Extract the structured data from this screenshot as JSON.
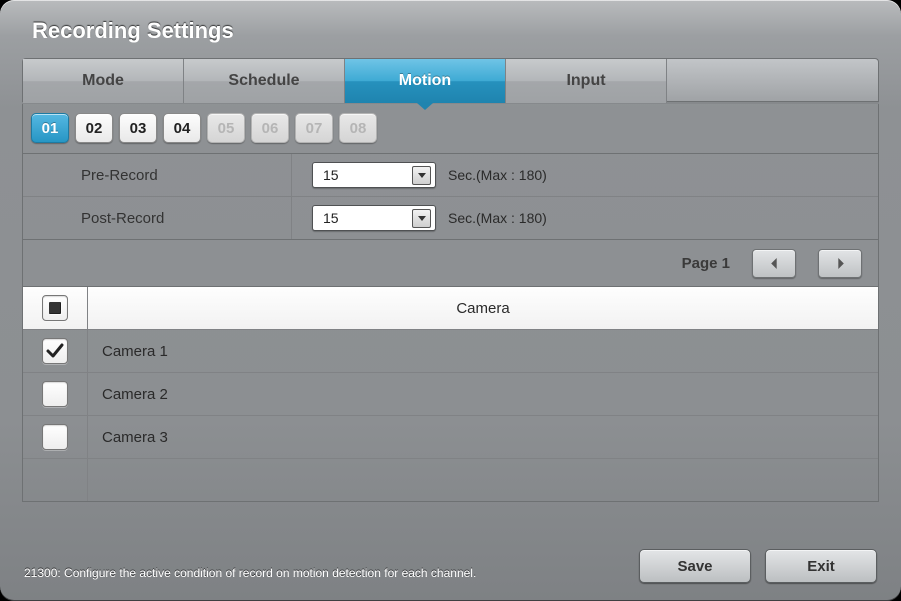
{
  "title": "Recording Settings",
  "tabs": [
    {
      "label": "Mode",
      "active": false
    },
    {
      "label": "Schedule",
      "active": false
    },
    {
      "label": "Motion",
      "active": true
    },
    {
      "label": "Input",
      "active": false
    }
  ],
  "channels": [
    {
      "label": "01",
      "state": "selected"
    },
    {
      "label": "02",
      "state": "enabled"
    },
    {
      "label": "03",
      "state": "enabled"
    },
    {
      "label": "04",
      "state": "enabled"
    },
    {
      "label": "05",
      "state": "disabled"
    },
    {
      "label": "06",
      "state": "disabled"
    },
    {
      "label": "07",
      "state": "disabled"
    },
    {
      "label": "08",
      "state": "disabled"
    }
  ],
  "settings": {
    "pre_record": {
      "label": "Pre-Record",
      "value": "15",
      "hint": "Sec.(Max : 180)"
    },
    "post_record": {
      "label": "Post-Record",
      "value": "15",
      "hint": "Sec.(Max : 180)"
    }
  },
  "pager": {
    "label": "Page 1"
  },
  "camera_table": {
    "header": "Camera",
    "master_check": "indeterminate",
    "rows": [
      {
        "name": "Camera 1",
        "checked": true
      },
      {
        "name": "Camera 2",
        "checked": false
      },
      {
        "name": "Camera 3",
        "checked": false
      }
    ],
    "blank_rows": 1
  },
  "status": {
    "code": "21300",
    "text": "Configure the active condition of record on motion detection for each channel."
  },
  "buttons": {
    "save": "Save",
    "exit": "Exit"
  }
}
